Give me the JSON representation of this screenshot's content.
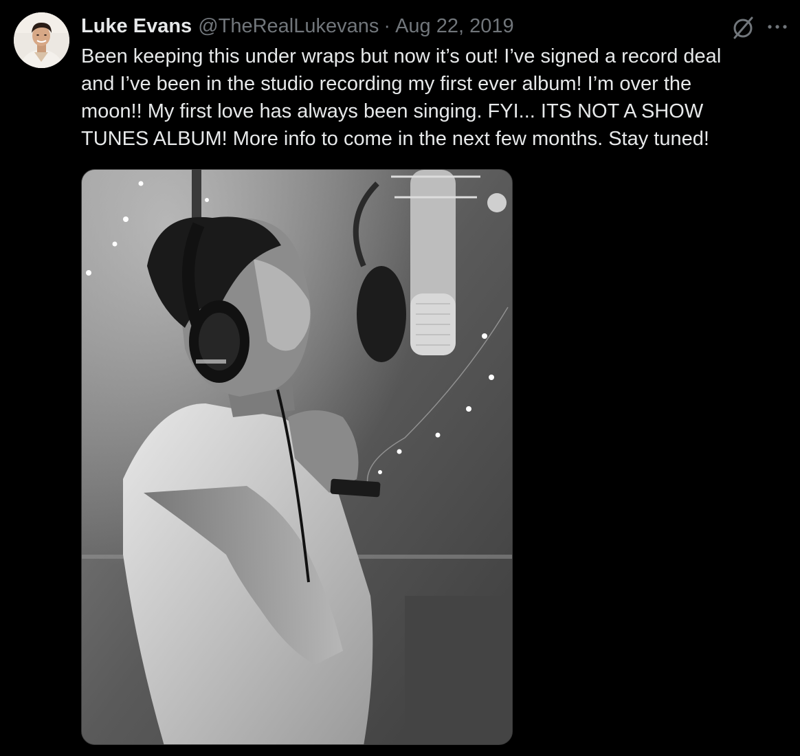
{
  "tweet": {
    "author": {
      "display_name": "Luke Evans",
      "handle": "@TheRealLukevans"
    },
    "separator": "·",
    "date": "Aug 22, 2019",
    "text_lines": [
      "Been keeping this under wraps but now it’s out! I’ve signed a record deal",
      "and I’ve been in the studio recording my first ever album! I’m over the",
      "moon!! My first love has always been singing. FYI... ITS NOT A SHOW",
      "TUNES ALBUM! More info to come in the next few months. Stay tuned!"
    ],
    "icons": {
      "grok": "grok-icon",
      "more": "more-icon"
    }
  },
  "colors": {
    "background": "#000000",
    "text_primary": "#e7e9ea",
    "text_secondary": "#71767b"
  }
}
